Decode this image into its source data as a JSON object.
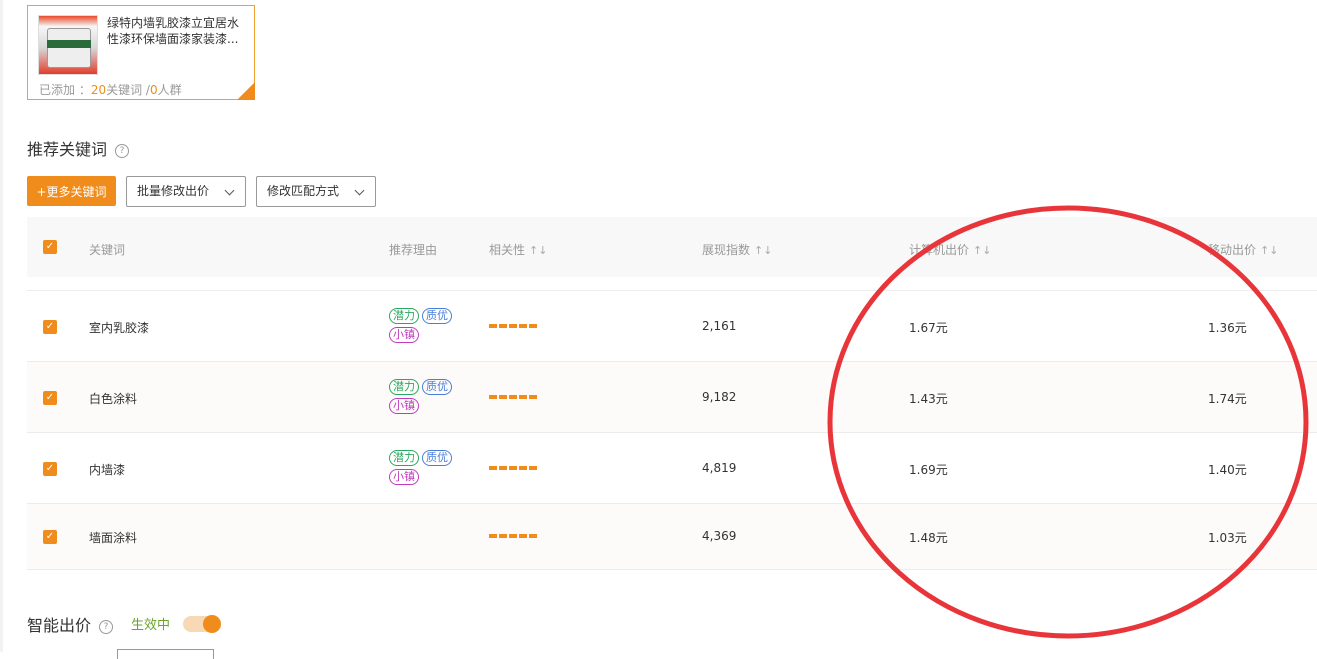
{
  "product": {
    "title": "绿特内墙乳胶漆立宜居水性漆环保墙面漆家装漆...",
    "meta_prefix": "已添加 ：",
    "keyword_count": "20",
    "keyword_label": "关键词 /",
    "crowd_count": "0",
    "crowd_label": "人群"
  },
  "recommend": {
    "title": "推荐关键词",
    "help_icon": "question-circle-icon",
    "add_button": "+更多关键词",
    "batch_bid": "批量修改出价",
    "match_mode": "修改匹配方式"
  },
  "table": {
    "headers": {
      "keyword": "关键词",
      "reason": "推荐理由",
      "relevance": "相关性",
      "impressions": "展现指数",
      "pc_bid": "计算机出价",
      "mobile_bid": "移动出价"
    },
    "rows": [
      {
        "keyword": "室内乳胶漆",
        "tags": [
          "潜力",
          "质优",
          "小镇"
        ],
        "relevance_level": 5,
        "impressions": "2,161",
        "pc_bid": "1.67元",
        "mobile_bid": "1.36元"
      },
      {
        "keyword": "白色涂料",
        "tags": [
          "潜力",
          "质优",
          "小镇"
        ],
        "relevance_level": 5,
        "impressions": "9,182",
        "pc_bid": "1.43元",
        "mobile_bid": "1.74元"
      },
      {
        "keyword": "内墙漆",
        "tags": [
          "潜力",
          "质优",
          "小镇"
        ],
        "relevance_level": 5,
        "impressions": "4,819",
        "pc_bid": "1.69元",
        "mobile_bid": "1.40元"
      },
      {
        "keyword": "墙面涂料",
        "tags": [],
        "relevance_level": 5,
        "impressions": "4,369",
        "pc_bid": "1.48元",
        "mobile_bid": "1.03元"
      }
    ]
  },
  "smart_bid": {
    "title": "智能出价",
    "status": "生效中",
    "enabled": true
  },
  "colors": {
    "accent": "#f08c1c",
    "annotation": "#e8353a",
    "tag_green": "#2aa760",
    "tag_blue": "#4a7fd8",
    "tag_purple": "#c03cbf"
  }
}
